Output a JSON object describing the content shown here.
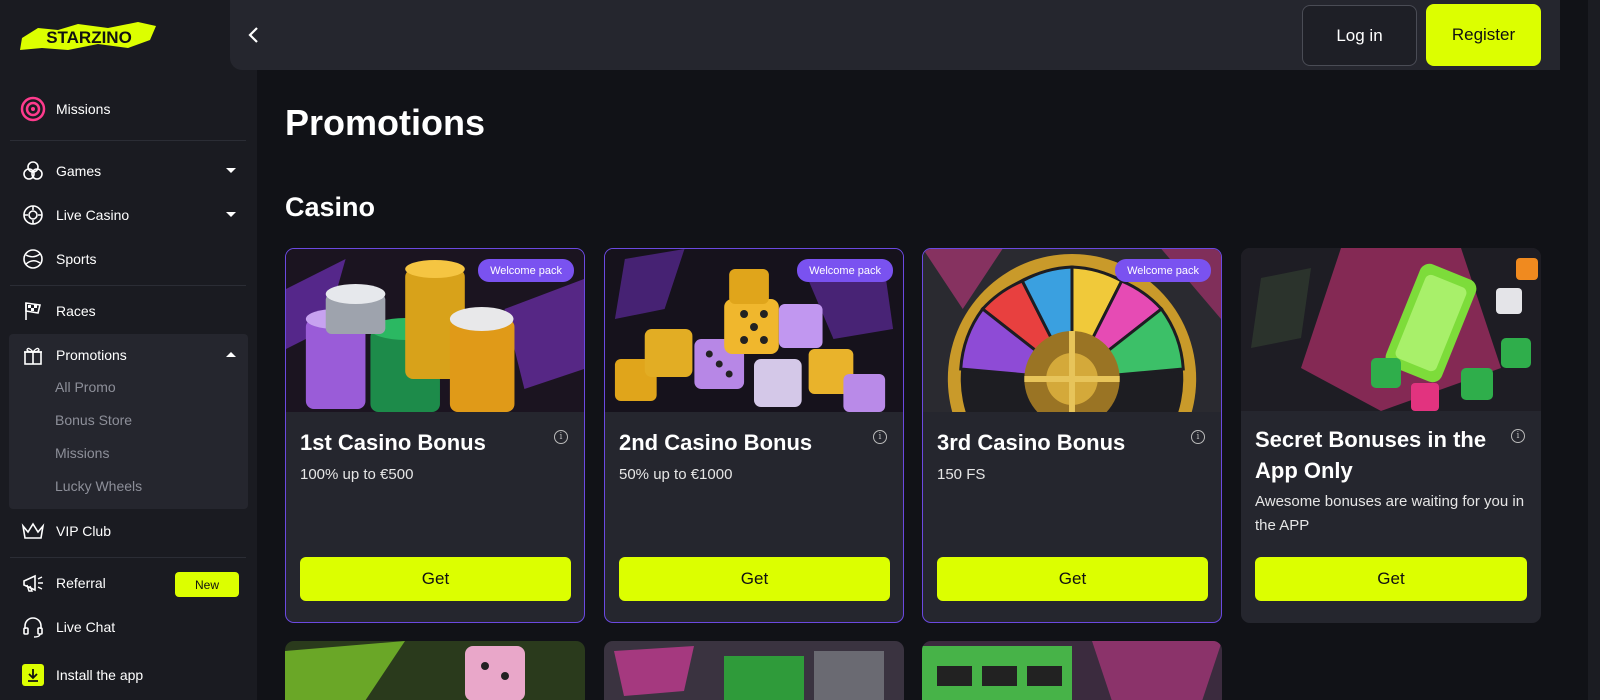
{
  "brand": {
    "name": "STARZINO",
    "accent": "#dcff00",
    "purple": "#7a52f0"
  },
  "sidebar": {
    "items": [
      {
        "label": "Missions",
        "icon": "target-icon"
      },
      {
        "label": "Games",
        "icon": "games-icon"
      },
      {
        "label": "Live Casino",
        "icon": "roulette-chip-icon"
      },
      {
        "label": "Sports",
        "icon": "ball-icon"
      },
      {
        "label": "Races",
        "icon": "checkered-flag-icon"
      },
      {
        "label": "Promotions",
        "icon": "gift-icon"
      },
      {
        "label": "VIP Club",
        "icon": "crown-icon"
      },
      {
        "label": "Referral",
        "icon": "megaphone-icon",
        "badge": "New"
      },
      {
        "label": "Live Chat",
        "icon": "headset-icon"
      },
      {
        "label": "Install the app",
        "icon": "download-icon"
      }
    ],
    "promo_sub": [
      "All Promo",
      "Bonus Store",
      "Missions",
      "Lucky Wheels"
    ]
  },
  "header": {
    "login": "Log in",
    "register": "Register"
  },
  "main": {
    "title": "Promotions",
    "section": "Casino",
    "cards": [
      {
        "badge": "Welcome pack",
        "title": "1st Casino Bonus",
        "subtitle": "100% up to €500",
        "button": "Get"
      },
      {
        "badge": "Welcome pack",
        "title": "2nd Casino Bonus",
        "subtitle": "50% up to €1000",
        "button": "Get"
      },
      {
        "badge": "Welcome pack",
        "title": "3rd Casino Bonus",
        "subtitle": "150 FS",
        "button": "Get"
      },
      {
        "title": "Secret Bonuses in the App Only",
        "subtitle": "Awesome bonuses are waiting for you in the APP",
        "button": "Get"
      }
    ]
  }
}
